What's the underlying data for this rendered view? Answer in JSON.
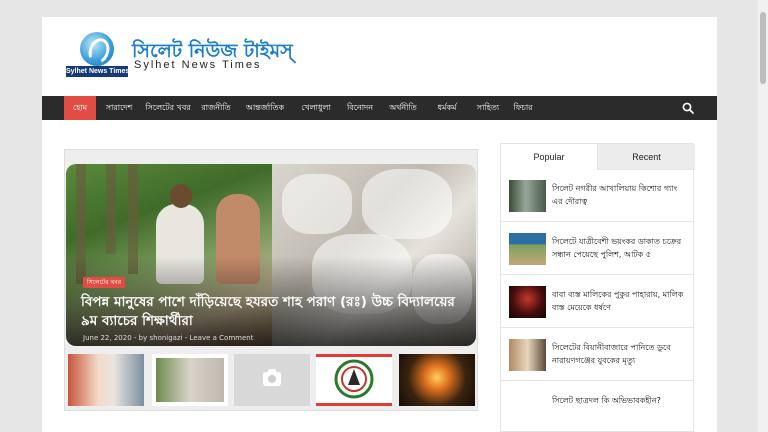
{
  "header": {
    "logo_text": "Sylhet News Times",
    "site_title": "সিলেট নিউজ টাইমস্",
    "site_subtitle": "Sylhet News Times"
  },
  "nav": {
    "items": [
      {
        "label": "হোম",
        "active": true
      },
      {
        "label": "সারাদেশ"
      },
      {
        "label": "সিলেটের খবর"
      },
      {
        "label": "রাজনীতি"
      },
      {
        "label": "আন্তর্জাতিক"
      },
      {
        "label": "খেলাধুলা"
      },
      {
        "label": "বিনোদন"
      },
      {
        "label": "অর্থনীতি"
      },
      {
        "label": "ধর্মকর্ম"
      },
      {
        "label": "সাহিত্য"
      },
      {
        "label": "ফিচার"
      }
    ],
    "search_icon": "search-icon"
  },
  "slider": {
    "category": "সিলেটের খবর",
    "title": "বিপন্ন মানুষের পাশে দাঁড়িয়েছে হযরত শাহ পরাণ (রঃ) উচ্চ বিদ্যালয়ের ৯ম ব্যাচের শিক্ষার্থীরা",
    "date": "June 22, 2020",
    "author_prefix": "by",
    "author": "shonigazi",
    "comment_link": "Leave a Comment",
    "thumb_icon": "camera-icon"
  },
  "sidebar": {
    "tabs": [
      {
        "label": "Popular",
        "active": true
      },
      {
        "label": "Recent"
      }
    ],
    "posts": [
      {
        "title": "সিলেট নগরীর আখালিয়ায় কিশোর গ্যাং এর দৌরাত্ব"
      },
      {
        "title": "সিলেটে যাত্রীবেশী ভয়ংকর ডাকাত চক্রের সন্ধান পেয়েছে পুলিশ, আটক ৫"
      },
      {
        "title": "বাবা ব্যস্ত মালিকের পুকুর পাহারায়, মালিক ব্যস্ত মেয়েকে ধর্ষণে"
      },
      {
        "title": "সিলেটের বিয়ানীবাজারে পানিতে ডুবে নারায়ণগঞ্জের যুবকের মৃত্যু"
      },
      {
        "title": "সিলেট ছাত্রদল কি অভিভাবকহীন?"
      }
    ]
  },
  "colors": {
    "accent": "#e14d43",
    "nav_bg": "#2b2b2b",
    "brand_blue": "#1a7fc9"
  }
}
